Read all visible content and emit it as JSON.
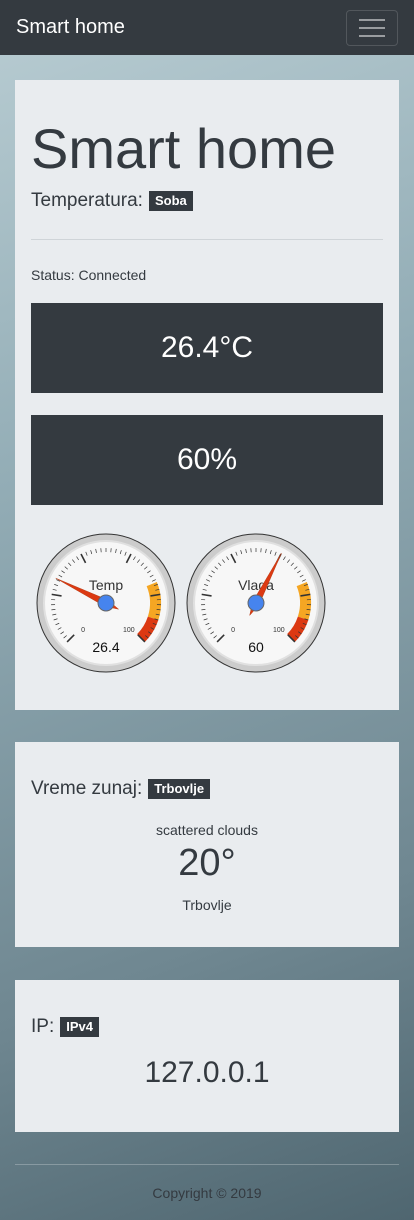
{
  "navbar": {
    "brand": "Smart home"
  },
  "sensors": {
    "title": "Smart home",
    "heading": "Temperatura:",
    "location_badge": "Soba",
    "status": "Status: Connected",
    "temperature_display": "26.4°C",
    "humidity_display": "60%",
    "gauges": [
      {
        "label": "Temp",
        "value": 26.4,
        "value_text": "26.4",
        "min": 0,
        "max": 100,
        "min_label": "0",
        "max_label": "100"
      },
      {
        "label": "Vlaga",
        "value": 60,
        "value_text": "60",
        "min": 0,
        "max": 100,
        "min_label": "0",
        "max_label": "100"
      }
    ],
    "colors": {
      "warning": "#f5a623",
      "danger": "#dc3912",
      "needle": "#dc3912",
      "hub": "#4684ee"
    }
  },
  "weather": {
    "heading": "Vreme zunaj:",
    "location_badge": "Trbovlje",
    "description": "scattered clouds",
    "temperature": "20°",
    "city": "Trbovlje"
  },
  "ip": {
    "heading": "IP:",
    "badge": "IPv4",
    "address": "127.0.0.1"
  },
  "footer": {
    "copyright": "Copyright © 2019"
  }
}
